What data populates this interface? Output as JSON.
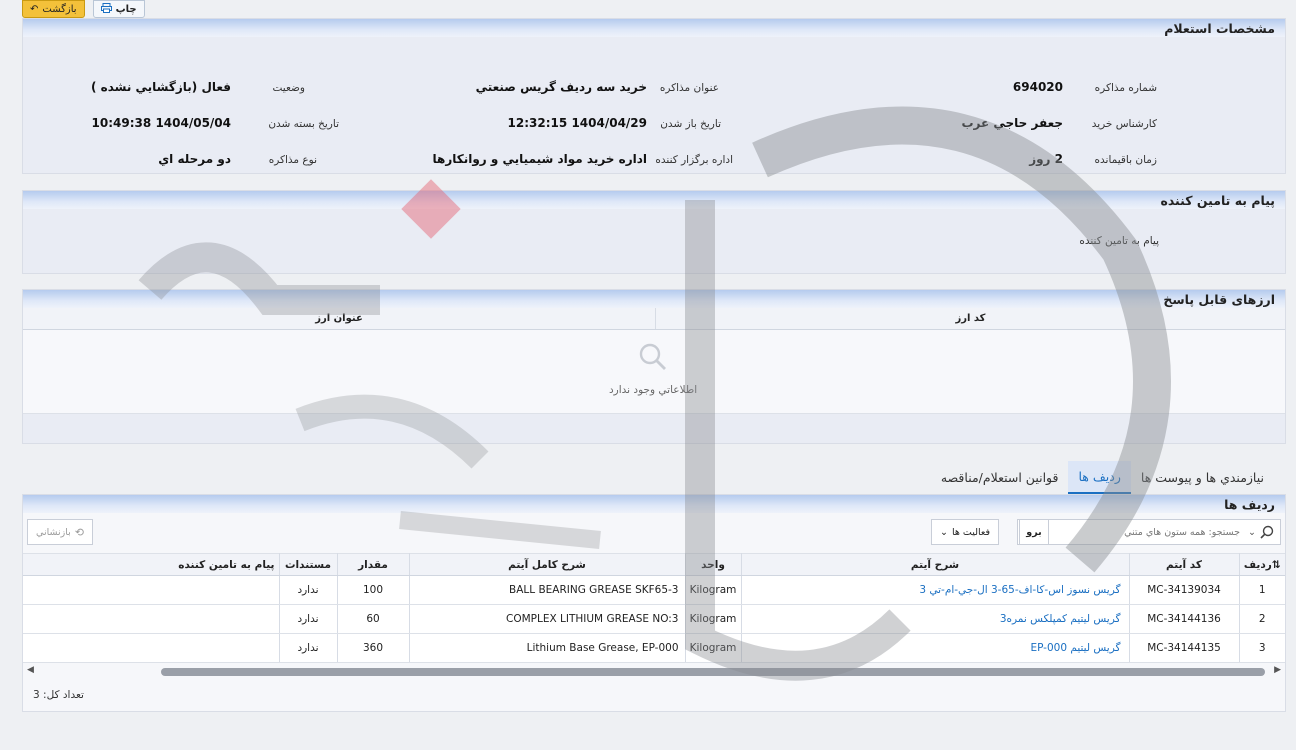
{
  "toolbar": {
    "back_label": "بازگشت",
    "print_label": "چاپ"
  },
  "details": {
    "title": "مشخصات استعلام",
    "fields": [
      {
        "label": "شماره مذاكره",
        "value": "694020"
      },
      {
        "label": "عنوان مذاكره",
        "value": "خريد سه رديف گريس صنعتي"
      },
      {
        "label": "وضعيت",
        "value": "فعال (بازگشايي نشده )"
      },
      {
        "label": "كارشناس خريد",
        "value": "جعفر حاجي عرب"
      },
      {
        "label": "تاريخ باز شدن",
        "value": "1404/04/29 12:32:15"
      },
      {
        "label": "تاريخ بسته شدن",
        "value": "1404/05/04 10:49:38"
      },
      {
        "label": "زمان باقيمانده",
        "value": "2 روز"
      },
      {
        "label": "اداره برگزار كننده",
        "value": "اداره خريد مواد شيميايي و روانكارها"
      },
      {
        "label": "نوع مذاكره",
        "value": "دو مرحله اي"
      }
    ]
  },
  "message": {
    "title": "پيام به تامين كننده",
    "label": "پيام به تامين كننده"
  },
  "currencies": {
    "title": "ارزهای قابل پاسخ",
    "columns": [
      "كد ارز",
      "عنوان ارز"
    ],
    "empty_text": "اطلاعاتي وجود ندارد"
  },
  "tabs": [
    {
      "label": "نيازمندي ها و پيوست ها",
      "active": false
    },
    {
      "label": "رديف ها",
      "active": true
    },
    {
      "label": "قوانين استعلام/مناقصه",
      "active": false
    }
  ],
  "rows_panel": {
    "title": "رديف ها",
    "search_placeholder": "جستجو: همه ستون هاي متني",
    "go_label": "برو",
    "actions_label": "فعاليت ها",
    "reset_label": "بازنشاني",
    "columns": [
      "رديف",
      "كد آيتم",
      "شرح آيتم",
      "واحد",
      "شرح كامل آيتم",
      "مقدار",
      "مستندات",
      "پيام به تامين كننده"
    ],
    "rows": [
      {
        "idx": "1",
        "code": "MC-34139034",
        "desc": "گريس نسوز اس-كا-اف-65-3 ال-جي-ام-تي 3",
        "unit": "Kilogram",
        "full": "BALL BEARING GREASE SKF65-3",
        "qty": "100",
        "docs": "ندارد",
        "msg": ""
      },
      {
        "idx": "2",
        "code": "MC-34144136",
        "desc": "گريس ليتيم كمپلكس نمره3",
        "unit": "Kilogram",
        "full": "COMPLEX LITHIUM GREASE NO:3",
        "qty": "60",
        "docs": "ندارد",
        "msg": ""
      },
      {
        "idx": "3",
        "code": "MC-34144135",
        "desc": "گريس ليتيم EP-000",
        "unit": "Kilogram",
        "full": "Lithium Base Grease, EP-000",
        "qty": "360",
        "docs": "ندارد",
        "msg": ""
      }
    ],
    "total_label": "تعداد كل: 3"
  },
  "colors": {
    "accent": "#1a6fc2",
    "header_gradient": "#b5cbee",
    "back_button": "#f3c13a"
  }
}
